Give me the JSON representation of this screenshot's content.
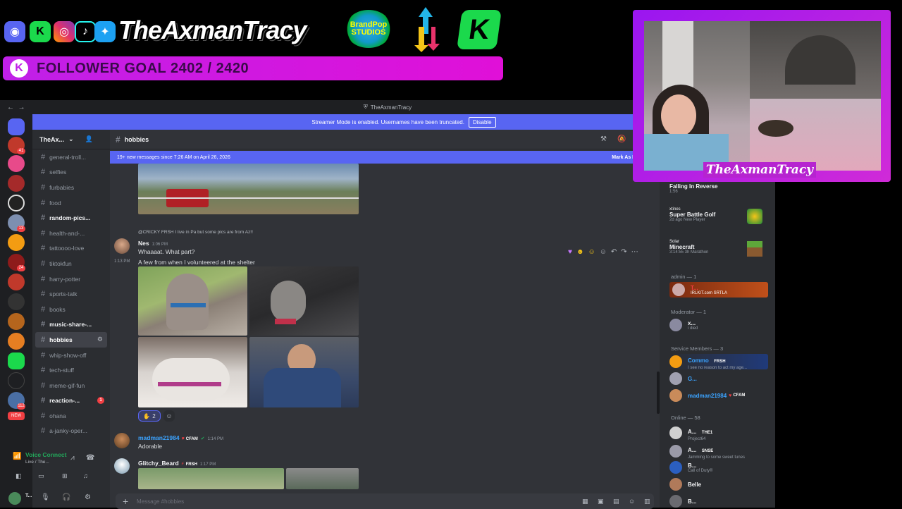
{
  "overlay": {
    "channel_name": "TheAxmanTracy",
    "follower_goal": "FOLLOWER GOAL 2402 / 2420",
    "brand_logo_text": "BrandPop STUDIOS",
    "cam_tag": "TheAxmanTracy",
    "social_icons": [
      "discord-icon",
      "kick-icon",
      "instagram-icon",
      "tiktok-icon",
      "twitter-icon"
    ]
  },
  "window": {
    "title": "TheAxmanTracy",
    "streamer_notice": "Streamer Mode is enabled. Usernames have been truncated.",
    "disable_label": "Disable"
  },
  "server": {
    "name": "TheAx..."
  },
  "channels": [
    {
      "name": "general-troll...",
      "bold": false
    },
    {
      "name": "selfies",
      "bold": false
    },
    {
      "name": "furbabies",
      "bold": false
    },
    {
      "name": "food",
      "bold": false
    },
    {
      "name": "random-pics...",
      "bold": true
    },
    {
      "name": "health-and-...",
      "bold": false
    },
    {
      "name": "tattoooo-love",
      "bold": false
    },
    {
      "name": "tiktokfun",
      "bold": false
    },
    {
      "name": "harry-potter",
      "bold": false
    },
    {
      "name": "sports-talk",
      "bold": false
    },
    {
      "name": "books",
      "bold": false
    },
    {
      "name": "music-share-...",
      "bold": true
    },
    {
      "name": "hobbies",
      "bold": true,
      "active": true
    },
    {
      "name": "whip-show-off",
      "bold": false
    },
    {
      "name": "tech-stuff",
      "bold": false
    },
    {
      "name": "meme-gif-fun",
      "bold": false
    },
    {
      "name": "reaction-...",
      "bold": true,
      "badge": "1"
    },
    {
      "name": "ohana",
      "bold": false
    },
    {
      "name": "a-janky-oper...",
      "bold": false
    }
  ],
  "voice": {
    "status": "Voice Connect",
    "sub": "Live / The..."
  },
  "user_panel": {
    "name": "T..."
  },
  "chat": {
    "channel": "hobbies",
    "new_messages": "19+ new messages since 7:26 AM on April 26, 2026",
    "mark_as_read": "Mark As Rea",
    "reply_preview": "@CRICKY  FRSH  I live in Pa but some pics are from Az!!",
    "msg1": {
      "author": "Nes",
      "time": "1:06 PM",
      "line1": "Whaaaat. What part?",
      "side_time": "1:13 PM",
      "line2": "A few from when I volunteered at the shelter",
      "reaction_count": "2"
    },
    "msg2": {
      "author": "madman21984",
      "tag": "CFAM",
      "time": "1:14 PM",
      "text": "Adorable"
    },
    "msg3": {
      "author": "Glitchy_Beard",
      "tag": "FRSH",
      "time": "1:17 PM"
    },
    "composer_placeholder": "Message #hobbies"
  },
  "activities": [
    {
      "title": "Falling In Reverse",
      "sub": "1:56"
    },
    {
      "user": "xtines",
      "title": "Super Battle Golf",
      "sub": "2d ago  New Player"
    },
    {
      "user": "Solar",
      "title": "Minecraft",
      "sub": "3:14:55  3h Marathon"
    }
  ],
  "members": {
    "admin_header": "admin — 1",
    "admin": {
      "name": "T...",
      "sub": "IRLKIT.com SRTLA"
    },
    "mod_header": "Moderator — 1",
    "mod": {
      "name": "x...",
      "sub": "i died"
    },
    "service_header": "Service Members — 3",
    "service": [
      {
        "name": "Commo",
        "tag": "FRSH",
        "sub": "I see no reason to act my age..."
      },
      {
        "name": "G...",
        "tag": "",
        "sub": ""
      },
      {
        "name": "madman21984",
        "tag": "CFAM",
        "sub": ""
      }
    ],
    "online_header": "Online — 58",
    "online": [
      {
        "name": "A...",
        "tag": "THE1",
        "sub": "Project64"
      },
      {
        "name": "A...",
        "tag": "SNSE",
        "sub": "Jamming to some sweet tunes"
      },
      {
        "name": "B...",
        "tag": "",
        "sub": "Call of Duty®"
      },
      {
        "name": "Belle",
        "tag": "",
        "sub": ""
      },
      {
        "name": "B...",
        "tag": "",
        "sub": ""
      }
    ]
  },
  "colors": {
    "blurple": "#5865f2",
    "overlay_pink": "#d01ce0",
    "online_green": "#23a55a"
  }
}
